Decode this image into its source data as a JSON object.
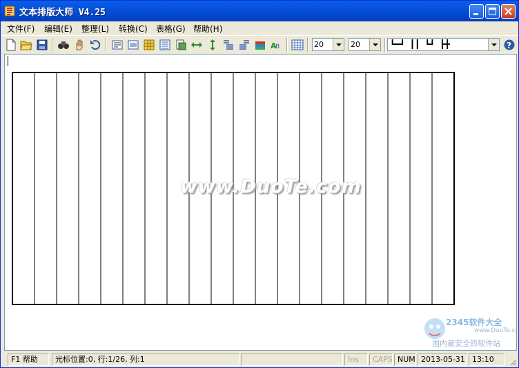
{
  "window": {
    "title": "文本排版大师 V4.25"
  },
  "menu": {
    "items": [
      "文件(F)",
      "编辑(E)",
      "整理(L)",
      "转换(C)",
      "表格(G)",
      "帮助(H)"
    ]
  },
  "toolbar": {
    "icons": [
      "new-file-icon",
      "open-folder-icon",
      "save-icon",
      "find-icon",
      "hand-icon",
      "undo-icon",
      "text-layout-icon",
      "text-box-icon",
      "grid-table-icon",
      "align-lines-icon",
      "page-icon",
      "horizontal-arrows-icon",
      "vertical-arrows-icon",
      "indent-icon",
      "outdent-icon",
      "books-icon",
      "ab-icon",
      "table-icon",
      "help-icon"
    ],
    "combo1_value": "20",
    "combo2_value": "20",
    "border_style_symbols": "┗━┛ ┃┃ ┗┛ ┣╋"
  },
  "editor": {
    "table_columns": 20,
    "watermark": "www.DuoTe.com",
    "corner_logo_brand": "2345软件大全",
    "corner_logo_sub": "国内最安全的软件站",
    "corner_logo_url": "www.DuoTe.com"
  },
  "status": {
    "help": "F1 帮助",
    "position": "光标位置:0, 行:1/26, 列:1",
    "ins": "Ins",
    "caps": "CAPS",
    "num": "NUM",
    "date": "2013-05-31",
    "time": "13:10"
  },
  "colors": {
    "titlebar": "#0551DD",
    "face": "#ECE9D8",
    "close_button": "#C83C1E"
  }
}
